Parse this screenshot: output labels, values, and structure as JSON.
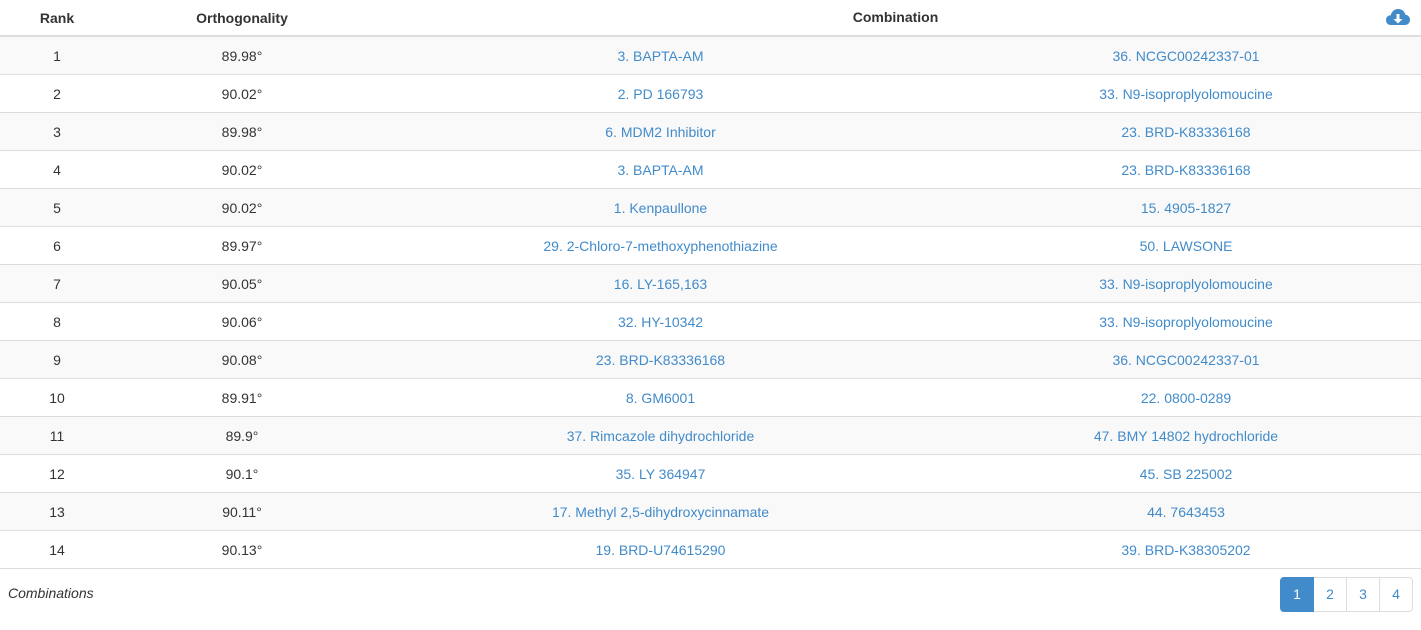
{
  "table": {
    "headers": {
      "rank": "Rank",
      "orthogonality": "Orthogonality",
      "combination": "Combination"
    },
    "download_icon": "cloud-download-icon",
    "rows": [
      {
        "rank": "1",
        "orthogonality": "89.98°",
        "drug_a": "3. BAPTA-AM",
        "drug_b": "36. NCGC00242337-01"
      },
      {
        "rank": "2",
        "orthogonality": "90.02°",
        "drug_a": "2. PD 166793",
        "drug_b": "33. N9-isoproplyolomoucine"
      },
      {
        "rank": "3",
        "orthogonality": "89.98°",
        "drug_a": "6. MDM2 Inhibitor",
        "drug_b": "23. BRD-K83336168"
      },
      {
        "rank": "4",
        "orthogonality": "90.02°",
        "drug_a": "3. BAPTA-AM",
        "drug_b": "23. BRD-K83336168"
      },
      {
        "rank": "5",
        "orthogonality": "90.02°",
        "drug_a": "1. Kenpaullone",
        "drug_b": "15. 4905-1827"
      },
      {
        "rank": "6",
        "orthogonality": "89.97°",
        "drug_a": "29. 2-Chloro-7-methoxyphenothiazine",
        "drug_b": "50. LAWSONE"
      },
      {
        "rank": "7",
        "orthogonality": "90.05°",
        "drug_a": "16. LY-165,163",
        "drug_b": "33. N9-isoproplyolomoucine"
      },
      {
        "rank": "8",
        "orthogonality": "90.06°",
        "drug_a": "32. HY-10342",
        "drug_b": "33. N9-isoproplyolomoucine"
      },
      {
        "rank": "9",
        "orthogonality": "90.08°",
        "drug_a": "23. BRD-K83336168",
        "drug_b": "36. NCGC00242337-01"
      },
      {
        "rank": "10",
        "orthogonality": "89.91°",
        "drug_a": "8. GM6001",
        "drug_b": "22. 0800-0289"
      },
      {
        "rank": "11",
        "orthogonality": "89.9°",
        "drug_a": "37. Rimcazole dihydrochloride",
        "drug_b": "47. BMY 14802 hydrochloride"
      },
      {
        "rank": "12",
        "orthogonality": "90.1°",
        "drug_a": "35. LY 364947",
        "drug_b": "45. SB 225002"
      },
      {
        "rank": "13",
        "orthogonality": "90.11°",
        "drug_a": "17. Methyl 2,5-dihydroxycinnamate",
        "drug_b": "44. 7643453"
      },
      {
        "rank": "14",
        "orthogonality": "90.13°",
        "drug_a": "19. BRD-U74615290",
        "drug_b": "39. BRD-K38305202"
      }
    ]
  },
  "footer": {
    "caption": "Combinations",
    "pages": [
      "1",
      "2",
      "3",
      "4"
    ],
    "active_page": "1"
  },
  "colors": {
    "link": "#428bca",
    "active_page_bg": "#428bca",
    "stripe": "#f9f9f9",
    "border": "#dddddd"
  }
}
